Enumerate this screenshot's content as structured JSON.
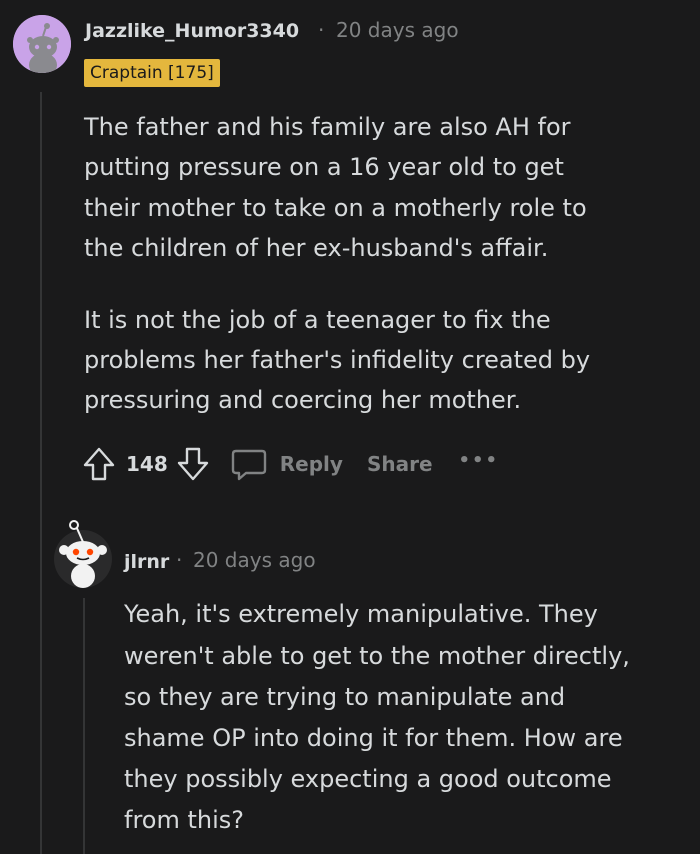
{
  "comment": {
    "username": "Jazzlike_Humor3340",
    "separator": "·",
    "time": "20 days ago",
    "flair": "Craptain [175]",
    "paragraphs": [
      [
        "The father and his family are also AH for",
        "putting pressure on a 16 year old to get",
        "their mother to take on a motherly role to",
        "the children of her ex-husband's affair."
      ],
      [
        "It is not the job of a teenager to fix the",
        "problems her father's infidelity created by",
        "pressuring and coercing her mother."
      ]
    ],
    "vote_count": "148",
    "reply_label": "Reply",
    "share_label": "Share",
    "more_label": "•••"
  },
  "reply": {
    "username": "jlrnr",
    "separator": "·",
    "time": "20 days ago",
    "lines": [
      "Yeah, it's extremely manipulative. They",
      "weren't able to get to the mother directly,",
      "so they are trying to manipulate and",
      "shame OP into doing it for them. How are",
      "they possibly expecting a good outcome",
      "from this?"
    ]
  },
  "icons": {
    "upvote": "upvote-arrow-icon",
    "downvote": "downvote-arrow-icon",
    "comment": "speech-bubble-icon",
    "more": "more-dots-icon"
  },
  "colors": {
    "background": "#1a1a1b",
    "text": "#d7dadc",
    "meta": "#818384",
    "flair_bg": "#e4b73d",
    "avatar1_bg": "#c9a3e8"
  }
}
